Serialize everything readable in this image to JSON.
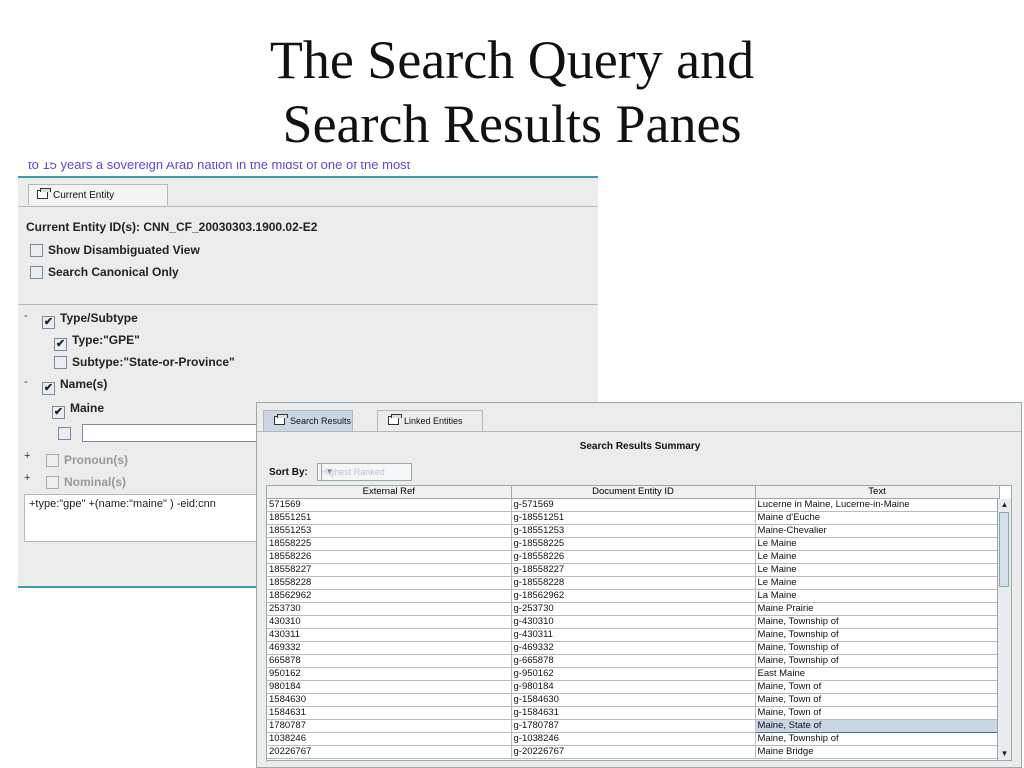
{
  "slide": {
    "title_line1": "The Search Query and",
    "title_line2": "Search Results Panes"
  },
  "entity_pane": {
    "doc_text": "to 15 years a sovereign Arab nation in the midst of one of the most",
    "tab_label": "Current Entity",
    "entity_id": "Current Entity ID(s): CNN_CF_20030303.1900.02-E2",
    "show_disambiguated": "Show Disambiguated View",
    "search_canonical": "Search Canonical Only",
    "type_subtype": "Type/Subtype",
    "type_value": "Type:\"GPE\"",
    "subtype_value": "Subtype:\"State-or-Province\"",
    "names": "Name(s)",
    "name_value": "Maine",
    "pronouns": "Pronoun(s)",
    "nominals": "Nominal(s)",
    "query": "+type:\"gpe\" +(name:\"maine\" ) -eid:cnn"
  },
  "results_pane": {
    "tabs": [
      "Search Results",
      "Linked Entities"
    ],
    "summary_title": "Search Results Summary",
    "sort_by_label": "Sort By:",
    "sort_value": "Highest Ranked",
    "columns": [
      "External Ref",
      "Document Entity ID",
      "Text"
    ],
    "rows": [
      [
        "571569",
        "g-571569",
        "Lucerne in Maine, Lucerne-in-Maine"
      ],
      [
        "18551251",
        "g-18551251",
        "Maine d'Euche"
      ],
      [
        "18551253",
        "g-18551253",
        "Maine-Chevalier"
      ],
      [
        "18558225",
        "g-18558225",
        "Le Maine"
      ],
      [
        "18558226",
        "g-18558226",
        "Le Maine"
      ],
      [
        "18558227",
        "g-18558227",
        "Le Maine"
      ],
      [
        "18558228",
        "g-18558228",
        "Le Maine"
      ],
      [
        "18562962",
        "g-18562962",
        "La Maine"
      ],
      [
        "253730",
        "g-253730",
        "Maine Prairie"
      ],
      [
        "430310",
        "g-430310",
        "Maine, Township of"
      ],
      [
        "430311",
        "g-430311",
        "Maine, Township of"
      ],
      [
        "469332",
        "g-469332",
        "Maine, Township of"
      ],
      [
        "665878",
        "g-665878",
        "Maine, Township of"
      ],
      [
        "950162",
        "g-950162",
        "East Maine"
      ],
      [
        "980184",
        "g-980184",
        "Maine, Town of"
      ],
      [
        "1584630",
        "g-1584630",
        "Maine, Town of"
      ],
      [
        "1584631",
        "g-1584631",
        "Maine, Town of"
      ],
      [
        "1780787",
        "g-1780787",
        "Maine, State of"
      ],
      [
        "1038246",
        "g-1038246",
        "Maine, Township of"
      ],
      [
        "20226767",
        "g-20226767",
        "Maine Bridge"
      ]
    ],
    "selected_row": 17
  }
}
